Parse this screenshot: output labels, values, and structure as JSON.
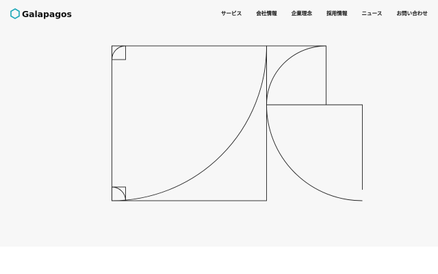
{
  "brand": {
    "name": "Galapagos",
    "accent_color": "#1aa7b8",
    "logo_icon": "hexagon-icon"
  },
  "nav": {
    "items": [
      {
        "label": "サービス"
      },
      {
        "label": "会社情報"
      },
      {
        "label": "企業理念"
      },
      {
        "label": "採用情報"
      },
      {
        "label": "ニュース"
      },
      {
        "label": "お問い合わせ"
      }
    ]
  },
  "hero": {
    "background_color": "#f7f7f7",
    "artwork": "geometric-line-art"
  }
}
